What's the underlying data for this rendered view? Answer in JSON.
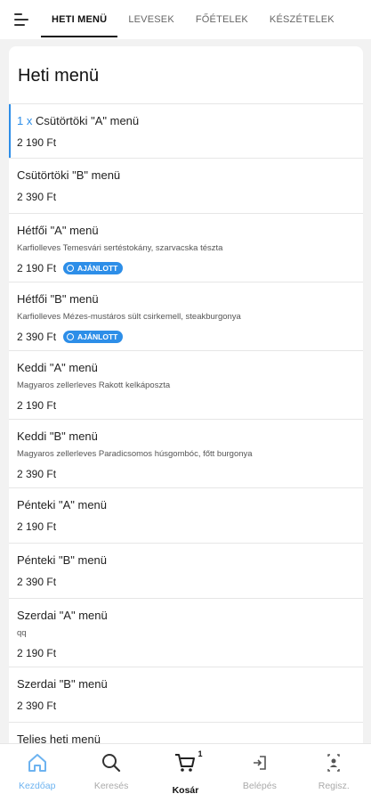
{
  "top_nav": {
    "tabs": [
      {
        "label": "HETI MENÜ",
        "active": true
      },
      {
        "label": "LEVESEK",
        "active": false
      },
      {
        "label": "FŐÉTELEK",
        "active": false
      },
      {
        "label": "KÉSZÉTELEK",
        "active": false
      }
    ]
  },
  "main": {
    "title": "Heti menü",
    "items": [
      {
        "qty": "1 x",
        "name": "Csütörtöki \"A\" menü",
        "desc": "",
        "price": "2 190 Ft",
        "badge": ""
      },
      {
        "qty": "",
        "name": "Csütörtöki \"B\" menü",
        "desc": "",
        "price": "2 390 Ft",
        "badge": ""
      },
      {
        "qty": "",
        "name": "Hétfői \"A\" menü",
        "desc": "Karfiolleves Temesvári sertéstokány, szarvacska tészta",
        "price": "2 190 Ft",
        "badge": "AJÁNLOTT"
      },
      {
        "qty": "",
        "name": "Hétfői \"B\" menü",
        "desc": "Karfiolleves Mézes-mustáros sült csirkemell, steakburgonya",
        "price": "2 390 Ft",
        "badge": "AJÁNLOTT"
      },
      {
        "qty": "",
        "name": "Keddi \"A\" menü",
        "desc": "Magyaros zellerleves Rakott kelkáposzta",
        "price": "2 190 Ft",
        "badge": ""
      },
      {
        "qty": "",
        "name": "Keddi \"B\" menü",
        "desc": "Magyaros zellerleves Paradicsomos húsgombóc, főtt burgonya",
        "price": "2 390 Ft",
        "badge": ""
      },
      {
        "qty": "",
        "name": "Pénteki \"A\" menü",
        "desc": "",
        "price": "2 190 Ft",
        "badge": ""
      },
      {
        "qty": "",
        "name": "Pénteki \"B\" menü",
        "desc": "",
        "price": "2 390 Ft",
        "badge": ""
      },
      {
        "qty": "",
        "name": "Szerdai \"A\" menü",
        "desc": "qq",
        "price": "2 190 Ft",
        "badge": ""
      },
      {
        "qty": "",
        "name": "Szerdai \"B\" menü",
        "desc": "",
        "price": "2 390 Ft",
        "badge": ""
      },
      {
        "qty": "",
        "name": "Teljes heti menü",
        "desc": "",
        "price": "",
        "badge": ""
      }
    ]
  },
  "bottom_nav": {
    "home": {
      "label": "Kezdőap",
      "icon": "home-icon"
    },
    "search": {
      "label": "Keresés",
      "icon": "search-icon"
    },
    "cart": {
      "label": "Kosár",
      "icon": "cart-icon",
      "count": "1"
    },
    "login": {
      "label": "Belépés",
      "icon": "login-icon"
    },
    "register": {
      "label": "Regisz.",
      "icon": "register-icon"
    }
  },
  "colors": {
    "accent": "#2d8ee8",
    "home_active": "#6db3f0"
  }
}
